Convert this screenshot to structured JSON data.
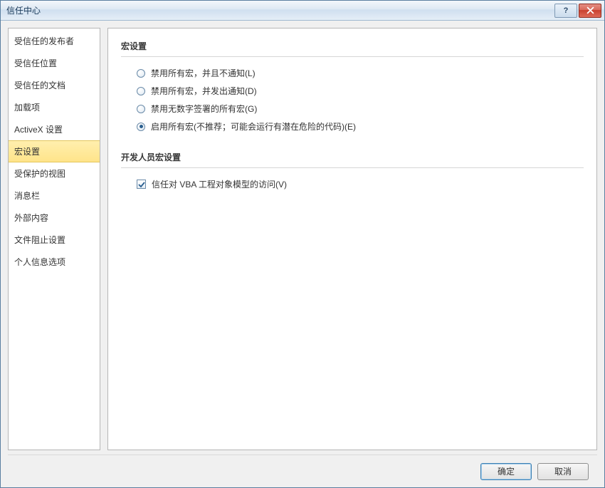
{
  "window": {
    "title": "信任中心"
  },
  "sidebar": {
    "items": [
      "受信任的发布者",
      "受信任位置",
      "受信任的文档",
      "加载项",
      "ActiveX 设置",
      "宏设置",
      "受保护的视图",
      "消息栏",
      "外部内容",
      "文件阻止设置",
      "个人信息选项"
    ],
    "selected_index": 5
  },
  "main": {
    "section1_title": "宏设置",
    "radios": [
      {
        "label": "禁用所有宏，并且不通知(L)",
        "checked": false
      },
      {
        "label": "禁用所有宏，并发出通知(D)",
        "checked": false
      },
      {
        "label": "禁用无数字签署的所有宏(G)",
        "checked": false
      },
      {
        "label": "启用所有宏(不推荐；可能会运行有潜在危险的代码)(E)",
        "checked": true
      }
    ],
    "section2_title": "开发人员宏设置",
    "checkbox": {
      "label": "信任对 VBA 工程对象模型的访问(V)",
      "checked": true
    }
  },
  "footer": {
    "ok": "确定",
    "cancel": "取消"
  }
}
